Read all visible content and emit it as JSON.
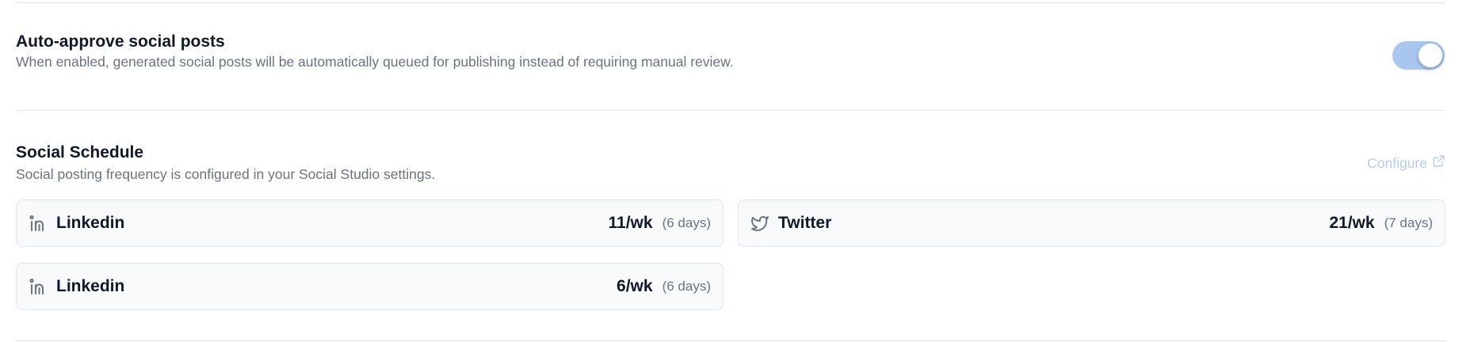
{
  "auto_approve": {
    "title": "Auto-approve social posts",
    "description": "When enabled, generated social posts will be automatically queued for publishing instead of requiring manual review.",
    "enabled": true
  },
  "social_schedule": {
    "title": "Social Schedule",
    "description": "Social posting frequency is configured in your Social Studio settings.",
    "configure_label": "Configure",
    "channels": [
      {
        "platform": "Linkedin",
        "icon": "linkedin-icon",
        "rate": "11/wk",
        "days": "(6 days)"
      },
      {
        "platform": "Twitter",
        "icon": "twitter-icon",
        "rate": "21/wk",
        "days": "(7 days)"
      },
      {
        "platform": "Linkedin",
        "icon": "linkedin-icon",
        "rate": "6/wk",
        "days": "(6 days)"
      }
    ]
  },
  "colors": {
    "toggle_on": "#a8c6ee",
    "link": "#b7cfea",
    "card_bg": "#f8f9fb"
  }
}
